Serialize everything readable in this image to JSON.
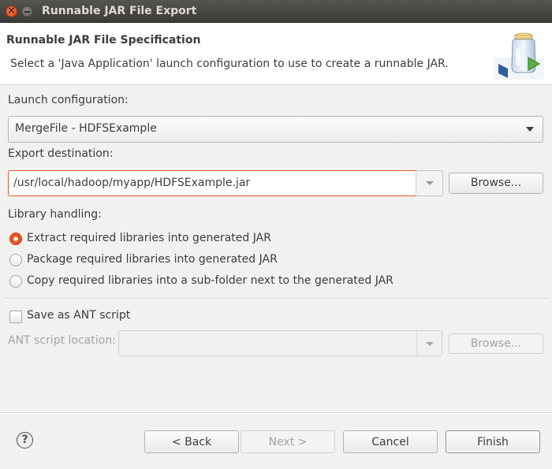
{
  "window": {
    "title": "Runnable JAR File Export"
  },
  "header": {
    "title": "Runnable JAR File Specification",
    "description": "Select a 'Java Application' launch configuration to use to create a runnable JAR.",
    "icon": "jar-export-wizard-icon"
  },
  "launch": {
    "label": "Launch configuration:",
    "value": "MergeFile - HDFSExample"
  },
  "export": {
    "label": "Export destination:",
    "value": "/usr/local/hadoop/myapp/HDFSExample.jar",
    "browse_label": "Browse..."
  },
  "library": {
    "label": "Library handling:",
    "options": [
      {
        "label": "Extract required libraries into generated JAR",
        "checked": true
      },
      {
        "label": "Package required libraries into generated JAR",
        "checked": false
      },
      {
        "label": "Copy required libraries into a sub-folder next to the generated JAR",
        "checked": false
      }
    ]
  },
  "ant": {
    "checkbox_label": "Save as ANT script",
    "checked": false,
    "location_label": "ANT script location:",
    "location_value": "",
    "browse_label": "Browse..."
  },
  "footer": {
    "back_label": "< Back",
    "next_label": "Next >",
    "cancel_label": "Cancel",
    "finish_label": "Finish"
  },
  "colors": {
    "accent": "#e95420",
    "background": "#f2f1f0",
    "titlebar": "#3c3b37"
  }
}
